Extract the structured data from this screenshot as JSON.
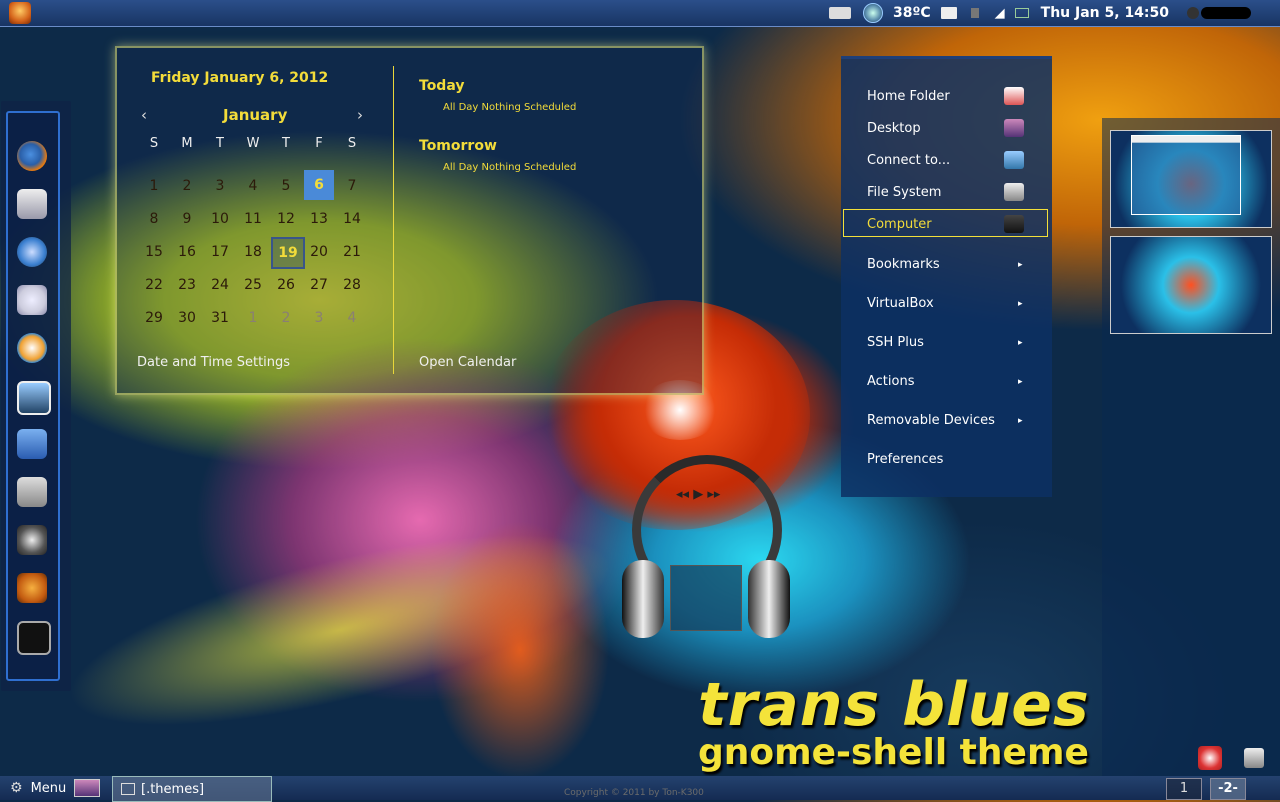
{
  "top_panel": {
    "temperature": "38ºC",
    "clock": "Thu Jan  5, 14:50"
  },
  "dock": {
    "items": [
      "firefox-icon",
      "mail-icon",
      "browser-icon",
      "chat-icon",
      "audio-player-icon",
      "image-viewer-icon",
      "text-document-icon",
      "file-cabinet-icon",
      "system-settings-icon",
      "gimp-icon",
      "terminal-icon"
    ]
  },
  "calendar": {
    "date_header": "Friday January  6, 2012",
    "month": "January",
    "prev": "‹",
    "next": "›",
    "weekdays": [
      "S",
      "M",
      "T",
      "W",
      "T",
      "F",
      "S"
    ],
    "weeks": [
      [
        "1",
        "2",
        "3",
        "4",
        "5",
        "6",
        "7"
      ],
      [
        "8",
        "9",
        "10",
        "11",
        "12",
        "13",
        "14"
      ],
      [
        "15",
        "16",
        "17",
        "18",
        "19",
        "20",
        "21"
      ],
      [
        "22",
        "23",
        "24",
        "25",
        "26",
        "27",
        "28"
      ],
      [
        "29",
        "30",
        "31",
        "1",
        "2",
        "3",
        "4"
      ]
    ],
    "selected_day": "6",
    "highlighted_day": "19",
    "today_label": "Today",
    "today_event": "All Day  Nothing Scheduled",
    "tomorrow_label": "Tomorrow",
    "tomorrow_event": "All Day  Nothing Scheduled",
    "settings_link": "Date and Time Settings",
    "open_calendar": "Open Calendar"
  },
  "places_menu": {
    "items": [
      {
        "label": "Home Folder",
        "icon": "home-icon"
      },
      {
        "label": "Desktop",
        "icon": "desktop-icon"
      },
      {
        "label": "Connect to...",
        "icon": "network-icon"
      },
      {
        "label": "File System",
        "icon": "drive-icon"
      },
      {
        "label": "Computer",
        "icon": "computer-icon"
      },
      {
        "label": "Bookmarks",
        "submenu": true
      },
      {
        "label": "VirtualBox",
        "submenu": true
      },
      {
        "label": "SSH Plus",
        "submenu": true
      },
      {
        "label": "Actions",
        "submenu": true
      },
      {
        "label": "Removable Devices",
        "submenu": true
      },
      {
        "label": "Preferences"
      }
    ],
    "submenu_arrow": "▸"
  },
  "media_controls": {
    "prev": "◂◂",
    "play": "▶",
    "next": "▸▸"
  },
  "branding": {
    "title": "trans blues",
    "subtitle": "gnome-shell theme",
    "copyright": "Copyright © 2011 by Ton-K300"
  },
  "bottom_panel": {
    "menu_label": "Menu",
    "task_label": "[.themes]",
    "workspaces": [
      "1",
      "-2-"
    ]
  },
  "colors": {
    "accent": "#f3dc3a",
    "panel": "#183463",
    "selection": "#4a8ad8"
  }
}
